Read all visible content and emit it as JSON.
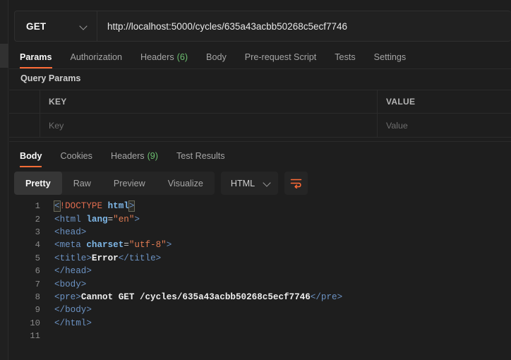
{
  "request": {
    "method": "GET",
    "method_chevron_icon": "chevron-down-icon",
    "url": "http://localhost:5000/cycles/635a43acbb50268c5ecf7746"
  },
  "request_tabs": [
    {
      "label": "Params",
      "count": "",
      "active": true
    },
    {
      "label": "Authorization",
      "count": "",
      "active": false
    },
    {
      "label": "Headers",
      "count": "(6)",
      "active": false
    },
    {
      "label": "Body",
      "count": "",
      "active": false
    },
    {
      "label": "Pre-request Script",
      "count": "",
      "active": false
    },
    {
      "label": "Tests",
      "count": "",
      "active": false
    },
    {
      "label": "Settings",
      "count": "",
      "active": false
    }
  ],
  "query_params": {
    "title": "Query Params",
    "headers": {
      "key": "KEY",
      "value": "VALUE"
    },
    "rows": [
      {
        "key_placeholder": "Key",
        "value_placeholder": "Value"
      }
    ]
  },
  "response_tabs": [
    {
      "label": "Body",
      "count": "",
      "active": true
    },
    {
      "label": "Cookies",
      "count": "",
      "active": false
    },
    {
      "label": "Headers",
      "count": "(9)",
      "active": false
    },
    {
      "label": "Test Results",
      "count": "",
      "active": false
    }
  ],
  "response_toolbar": {
    "view_modes": [
      {
        "label": "Pretty",
        "active": true
      },
      {
        "label": "Raw",
        "active": false
      },
      {
        "label": "Preview",
        "active": false
      },
      {
        "label": "Visualize",
        "active": false
      }
    ],
    "language": "HTML",
    "language_chevron_icon": "chevron-down-icon",
    "wrap_icon": "wrap-text-icon"
  },
  "code": {
    "line_numbers": [
      "1",
      "2",
      "3",
      "4",
      "5",
      "6",
      "7",
      "8",
      "9",
      "10",
      "11"
    ],
    "lines": [
      "<!DOCTYPE html>",
      "<html lang=\"en\">",
      "<head>",
      "<meta charset=\"utf-8\">",
      "<title>Error</title>",
      "</head>",
      "<body>",
      "<pre>Cannot GET /cycles/635a43acbb50268c5ecf7746</pre>",
      "</body>",
      "</html>",
      ""
    ]
  },
  "colors": {
    "accent": "#ff6c37",
    "count_green": "#6cc070",
    "background": "#1e1e1e",
    "panel": "#212121",
    "border": "#2b2b2b"
  }
}
